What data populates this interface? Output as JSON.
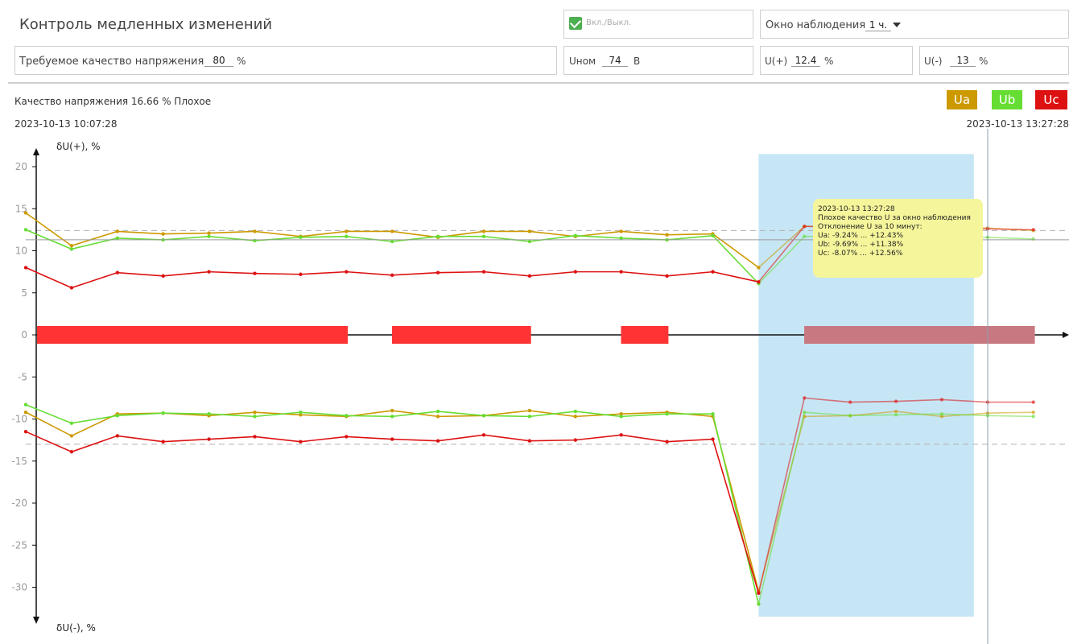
{
  "header": {
    "title": "Контроль медленных изменений",
    "enable_label": "Вкл./Выкл.",
    "window_label": "Окно наблюдения",
    "window_value": "1 ч."
  },
  "params": {
    "quality_label": "Требуемое качество напряжения",
    "quality_value": "80",
    "quality_unit": "%",
    "unom_label": "Uном",
    "unom_value": "74",
    "unom_unit": "В",
    "uplus_label": "U(+)",
    "uplus_value": "12.4",
    "uplus_unit": "%",
    "uminus_label": "U(-)",
    "uminus_value": "13",
    "uminus_unit": "%"
  },
  "status": {
    "quality_text": "Качество напряжения  16.66 % Плохое",
    "time_start": "2023-10-13 10:07:28",
    "time_end": "2023-10-13 13:27:28"
  },
  "legend": [
    {
      "label": "Ua",
      "color": "#cc9900"
    },
    {
      "label": "Ub",
      "color": "#66dd33"
    },
    {
      "label": "Uc",
      "color": "#dd1111"
    }
  ],
  "tooltip": {
    "line1": "2023-10-13 13:27:28",
    "line2": "Плохое качество U за окно наблюдения",
    "line3": "Отклонение U за 10 минут:",
    "line4": "Ua: -9.24% ... +12.43%",
    "line5": "Ub: -9.69% ... +11.38%",
    "line6": "Uc: -8.07% ... +12.56%"
  },
  "chart_data": {
    "type": "line",
    "ylabel_top": "δU(+), %",
    "ylabel_bottom": "δU(-), %",
    "yticks": [
      20,
      15,
      10,
      5,
      0,
      -5,
      -10,
      -15,
      -20,
      -25,
      -30
    ],
    "ylim": [
      -34,
      22
    ],
    "x_count": 23,
    "thresholds": [
      12.4,
      -13
    ],
    "series_positive": [
      {
        "name": "Ua",
        "color": "#cc9900",
        "values": [
          14.5,
          10.6,
          12.3,
          12.0,
          12.1,
          12.3,
          11.7,
          12.3,
          12.3,
          11.6,
          12.3,
          12.3,
          11.7,
          12.3,
          11.9,
          12.0,
          8.0,
          12.9,
          12.9,
          12.9,
          12.8,
          12.7,
          12.4
        ]
      },
      {
        "name": "Ub",
        "color": "#66dd33",
        "values": [
          12.5,
          10.2,
          11.5,
          11.3,
          11.7,
          11.2,
          11.6,
          11.7,
          11.1,
          11.7,
          11.7,
          11.1,
          11.8,
          11.5,
          11.3,
          11.8,
          6.1,
          11.7,
          11.7,
          11.6,
          11.7,
          11.6,
          11.4
        ]
      },
      {
        "name": "Uc",
        "color": "#dd1111",
        "values": [
          8.0,
          5.6,
          7.4,
          7.0,
          7.5,
          7.3,
          7.2,
          7.5,
          7.1,
          7.4,
          7.5,
          7.0,
          7.5,
          7.5,
          7.0,
          7.5,
          6.3,
          12.9,
          12.8,
          12.7,
          12.6,
          12.6,
          12.5
        ]
      }
    ],
    "series_negative": [
      {
        "name": "Ua",
        "color": "#cc9900",
        "values": [
          -9.2,
          -12.0,
          -9.4,
          -9.3,
          -9.6,
          -9.2,
          -9.5,
          -9.7,
          -9.0,
          -9.7,
          -9.6,
          -9.0,
          -9.7,
          -9.4,
          -9.2,
          -9.7,
          -30.5,
          -9.7,
          -9.6,
          -9.1,
          -9.7,
          -9.3,
          -9.2
        ]
      },
      {
        "name": "Ub",
        "color": "#66dd33",
        "values": [
          -8.3,
          -10.5,
          -9.6,
          -9.3,
          -9.4,
          -9.7,
          -9.2,
          -9.6,
          -9.7,
          -9.1,
          -9.6,
          -9.7,
          -9.1,
          -9.7,
          -9.4,
          -9.4,
          -32.0,
          -9.2,
          -9.6,
          -9.5,
          -9.4,
          -9.6,
          -9.7
        ]
      },
      {
        "name": "Uc",
        "color": "#dd1111",
        "values": [
          -11.5,
          -13.9,
          -12.0,
          -12.7,
          -12.4,
          -12.1,
          -12.7,
          -12.1,
          -12.4,
          -12.6,
          -11.9,
          -12.6,
          -12.5,
          -11.9,
          -12.7,
          -12.4,
          -30.7,
          -7.5,
          -8.0,
          -7.9,
          -7.7,
          -8.0,
          -8.0
        ]
      }
    ],
    "bad_segments": [
      [
        0,
        6.75
      ],
      [
        7.75,
        10.75
      ],
      [
        12.75,
        13.75
      ],
      [
        16.75,
        21.75
      ]
    ],
    "selection": [
      16,
      20.7
    ]
  }
}
